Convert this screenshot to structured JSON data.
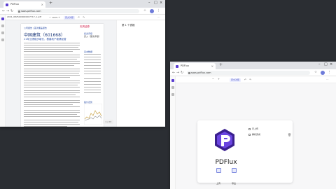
{
  "left_window": {
    "tab_title": "PDFlux",
    "new_tab": "+",
    "url": "saas.pdflux.com",
    "file_name": "2021_0825400000007717_1.pdf",
    "toolbar": {
      "zoom": "100%",
      "mode_label": "原文对照"
    },
    "right_panel_title": "第 1 个表格",
    "pager": "1 / 23",
    "page": {
      "header_left": "公司报告 | 首次覆盖报告",
      "brand": "天风证券",
      "company_title": "中国建筑（601668）",
      "subtitle": "21年业绩稳步增长，基建地产稳健经营",
      "investment_label": "投资评级",
      "rating": "买入（首次评级）",
      "section_heading": "基本数据",
      "chart_heading": "股价走势"
    }
  },
  "right_window": {
    "tab_title": "PDFlux",
    "new_tab": "+",
    "url": "saas.pdflux.com",
    "toolbar": {
      "mode_label": "原文对照"
    },
    "upload_panel": {
      "brand": "PDFlux",
      "btn1": "上传",
      "btn2": "导出",
      "row1": "已上传",
      "row2": "解析完成"
    }
  }
}
